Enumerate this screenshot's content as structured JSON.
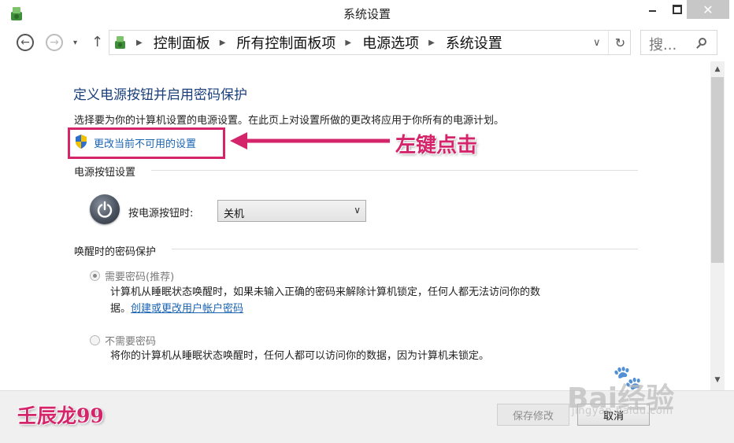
{
  "window": {
    "title": "系统设置",
    "close_symbol": "✕"
  },
  "navbar": {
    "back_symbol": "←",
    "forward_symbol": "→",
    "dropdown_symbol": "▾",
    "up_symbol": "↑",
    "breadcrumbs": [
      "控制面板",
      "所有控制面板项",
      "电源选项",
      "系统设置"
    ],
    "crumb_sep": "▶",
    "address_dropdown_symbol": "∨",
    "refresh_symbol": "↻",
    "search_placeholder": "搜..."
  },
  "content": {
    "title": "定义电源按钮并启用密码保护",
    "description": "选择要为你的计算机设置的电源设置。在此页上对设置所做的更改将应用于你所有的电源计划。",
    "change_link": "更改当前不可用的设置",
    "annotation": "左键点击",
    "power_section": {
      "heading": "电源按钮设置",
      "label": "按电源按钮时:",
      "selected_value": "关机",
      "arrow": "∨"
    },
    "password_section": {
      "heading": "唤醒时的密码保护",
      "option_require": {
        "label": "需要密码(推荐)",
        "desc_line1": "计算机从睡眠状态唤醒时，如果未输入正确的密码来解除计算机锁定，任何人都无法访问你的数",
        "desc_line2_prefix": "据。",
        "link": "创建或更改用户帐户密码",
        "checked": true
      },
      "option_none": {
        "label": "不需要密码",
        "desc": "将你的计算机从睡眠状态唤醒时，任何人都可以访问你的数据，因为计算机未锁定。",
        "checked": false
      }
    }
  },
  "scrollbar": {
    "up_symbol": "▲",
    "down_symbol": "▼"
  },
  "footer": {
    "save_label": "保存修改",
    "cancel_label": "取消",
    "author_watermark": "壬辰龙99",
    "baidu_watermark": "Bai经验",
    "baidu_sub": "jingyan.baidu.com"
  },
  "colors": {
    "accent_pink": "#d4246a",
    "link_blue": "#1a64b4",
    "title_blue": "#1a3f7a"
  }
}
